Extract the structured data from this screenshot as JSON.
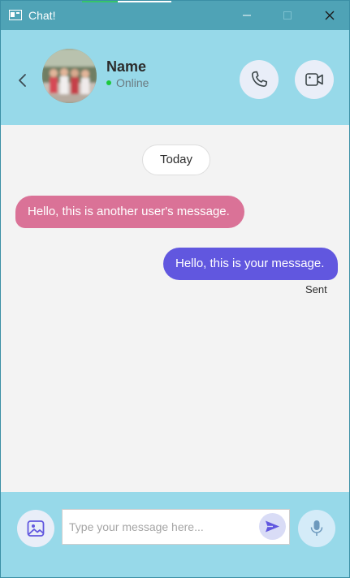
{
  "window": {
    "title": "Chat!",
    "controls": [
      "minimize-icon",
      "maximize-icon",
      "close-icon"
    ]
  },
  "header": {
    "contact_name": "Name",
    "status": "Online",
    "status_color": "#1cc93a",
    "icons": {
      "back": "chevron-left-icon",
      "call": "phone-icon",
      "video": "video-camera-icon"
    }
  },
  "conversation": {
    "date_label": "Today",
    "messages": [
      {
        "direction": "incoming",
        "text": "Hello, this is another user's message.",
        "color": "#da7297"
      },
      {
        "direction": "outgoing",
        "text": "Hello, this is your message.",
        "status": "Sent",
        "color": "#6157df"
      }
    ]
  },
  "composer": {
    "placeholder": "Type your message here...",
    "value": "",
    "icons": {
      "attach_image": "image-icon",
      "send": "send-icon",
      "mic": "microphone-icon"
    }
  },
  "colors": {
    "titlebar": "#4fa3b6",
    "header_bg": "#97d9e9",
    "chat_bg": "#f3f3f3",
    "accent": "#6157df"
  }
}
